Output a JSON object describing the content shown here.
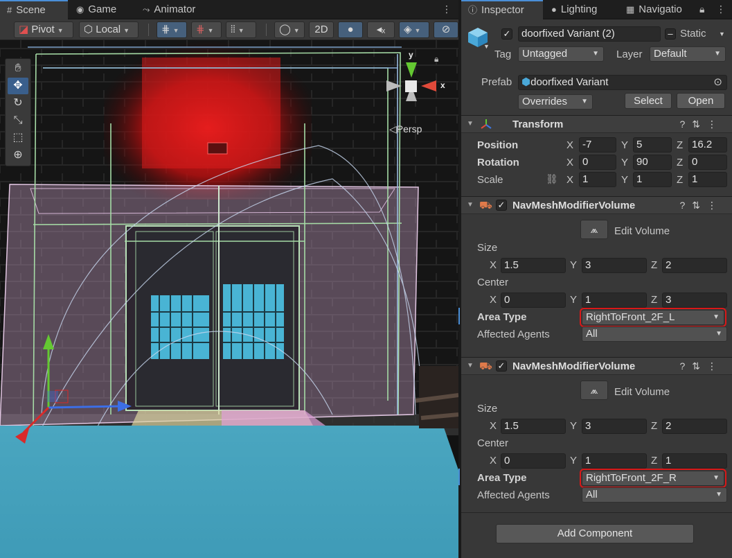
{
  "scene_tabs": [
    {
      "label": "Scene",
      "icon": "grid-icon"
    },
    {
      "label": "Game",
      "icon": "gamepad-icon"
    },
    {
      "label": "Animator",
      "icon": "animator-icon"
    }
  ],
  "scene_toolbar": {
    "pivot": "Pivot",
    "space": "Local",
    "mode_2d": "2D"
  },
  "viewport": {
    "orientation_label": "Persp",
    "gizmo_axes": {
      "x": "x",
      "y": "y"
    }
  },
  "inspector_tabs": [
    {
      "label": "Inspector",
      "icon": "info-icon"
    },
    {
      "label": "Lighting",
      "icon": "lightbulb-icon"
    },
    {
      "label": "Navigatio",
      "icon": "navigation-icon"
    }
  ],
  "gameobject": {
    "active": true,
    "name": "doorfixed Variant (2)",
    "static_label": "Static",
    "tag_label": "Tag",
    "tag_value": "Untagged",
    "layer_label": "Layer",
    "layer_value": "Default",
    "prefab_label": "Prefab",
    "prefab_value": "doorfixed Variant",
    "overrides_label": "Overrides",
    "select_label": "Select",
    "open_label": "Open"
  },
  "transform": {
    "title": "Transform",
    "position_label": "Position",
    "rotation_label": "Rotation",
    "scale_label": "Scale",
    "position": {
      "x": "-7",
      "y": "5",
      "z": "16.2"
    },
    "rotation": {
      "x": "0",
      "y": "90",
      "z": "0"
    },
    "scale": {
      "x": "1",
      "y": "1",
      "z": "1"
    }
  },
  "axis_labels": {
    "x": "X",
    "y": "Y",
    "z": "Z"
  },
  "volumes": [
    {
      "title": "NavMeshModifierVolume",
      "enabled": true,
      "edit_label": "Edit Volume",
      "size_label": "Size",
      "center_label": "Center",
      "size": {
        "x": "1.5",
        "y": "3",
        "z": "2"
      },
      "center": {
        "x": "0",
        "y": "1",
        "z": "3"
      },
      "area_type_label": "Area Type",
      "area_type": "RightToFront_2F_L",
      "agents_label": "Affected Agents",
      "agents": "All"
    },
    {
      "title": "NavMeshModifierVolume",
      "enabled": true,
      "edit_label": "Edit Volume",
      "size_label": "Size",
      "center_label": "Center",
      "size": {
        "x": "1.5",
        "y": "3",
        "z": "2"
      },
      "center": {
        "x": "0",
        "y": "1",
        "z": "1"
      },
      "area_type_label": "Area Type",
      "area_type": "RightToFront_2F_R",
      "agents_label": "Affected Agents",
      "agents": "All"
    }
  ],
  "add_component_label": "Add Component",
  "colors": {
    "highlight": "#d81818",
    "accent": "#4a8fd8",
    "navmesh_area": "#5ab8d8"
  }
}
